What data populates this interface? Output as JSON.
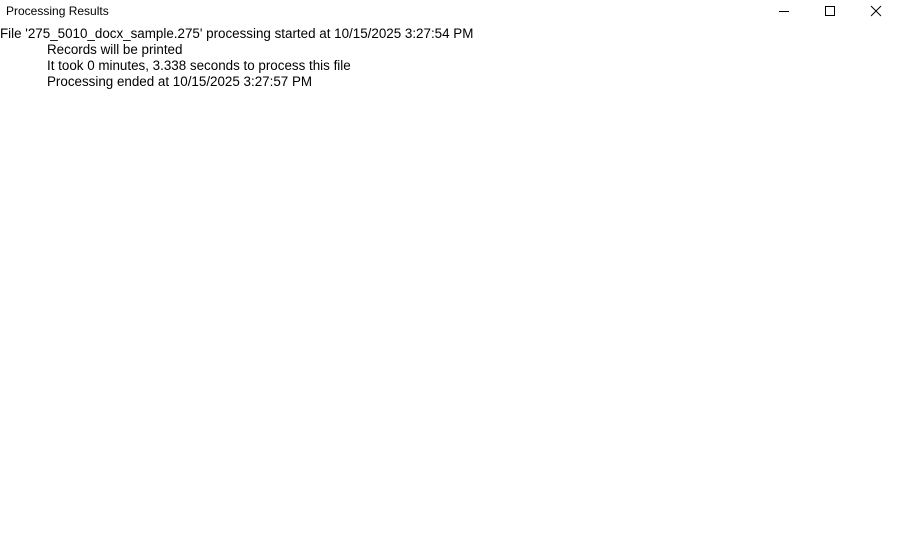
{
  "window": {
    "title": "Processing Results",
    "controls": {
      "minimize_icon": "minimize-icon",
      "maximize_icon": "maximize-icon",
      "close_icon": "close-icon"
    }
  },
  "log": {
    "header": "File '275_5010_docx_sample.275' processing started at 10/15/2025 3:27:54 PM",
    "details": [
      "Records will be printed",
      "It took 0 minutes, 3.338 seconds to process this file",
      "Processing  ended at 10/15/2025 3:27:57 PM"
    ]
  },
  "colors": {
    "background": "#ffffff",
    "text": "#000000"
  }
}
